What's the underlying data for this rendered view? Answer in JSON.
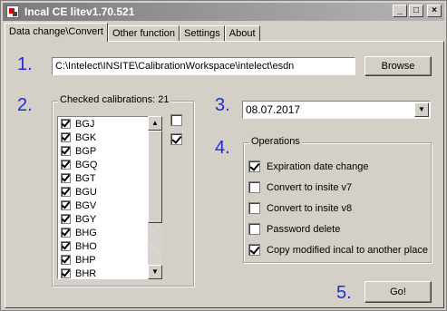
{
  "window": {
    "title": "Incal CE litev1.70.521",
    "controls": [
      "_",
      "□",
      "×"
    ]
  },
  "tabs": [
    "Data change\\Convert",
    "Other function",
    "Settings",
    "About"
  ],
  "steps": [
    "1.",
    "2.",
    "3.",
    "4.",
    "5."
  ],
  "path": {
    "value": "C:\\Intelect\\INSITE\\CalibrationWorkspace\\intelect\\esdn",
    "browse_label": "Browse"
  },
  "calibrations": {
    "label": "Checked calibrations: 21",
    "items": [
      {
        "name": "BGJ",
        "checked": true
      },
      {
        "name": "BGK",
        "checked": true
      },
      {
        "name": "BGP",
        "checked": true
      },
      {
        "name": "BGQ",
        "checked": true
      },
      {
        "name": "BGT",
        "checked": true
      },
      {
        "name": "BGU",
        "checked": true
      },
      {
        "name": "BGV",
        "checked": true
      },
      {
        "name": "BGY",
        "checked": true
      },
      {
        "name": "BHG",
        "checked": true
      },
      {
        "name": "BHO",
        "checked": true
      },
      {
        "name": "BHP",
        "checked": true
      },
      {
        "name": "BHR",
        "checked": true
      }
    ],
    "select_none_checked": false,
    "select_all_checked": true
  },
  "date": {
    "value": "08.07.2017"
  },
  "operations": {
    "label": "Operations",
    "items": [
      {
        "label": "Expiration date change",
        "checked": true
      },
      {
        "label": "Convert to insite v7",
        "checked": false
      },
      {
        "label": "Convert to insite v8",
        "checked": false
      },
      {
        "label": "Password delete",
        "checked": false
      },
      {
        "label": "Copy modified incal to another place",
        "checked": true
      }
    ]
  },
  "go_label": "Go!",
  "colors": {
    "step_number": "#1f2dd6",
    "face": "#d4d0c8"
  }
}
